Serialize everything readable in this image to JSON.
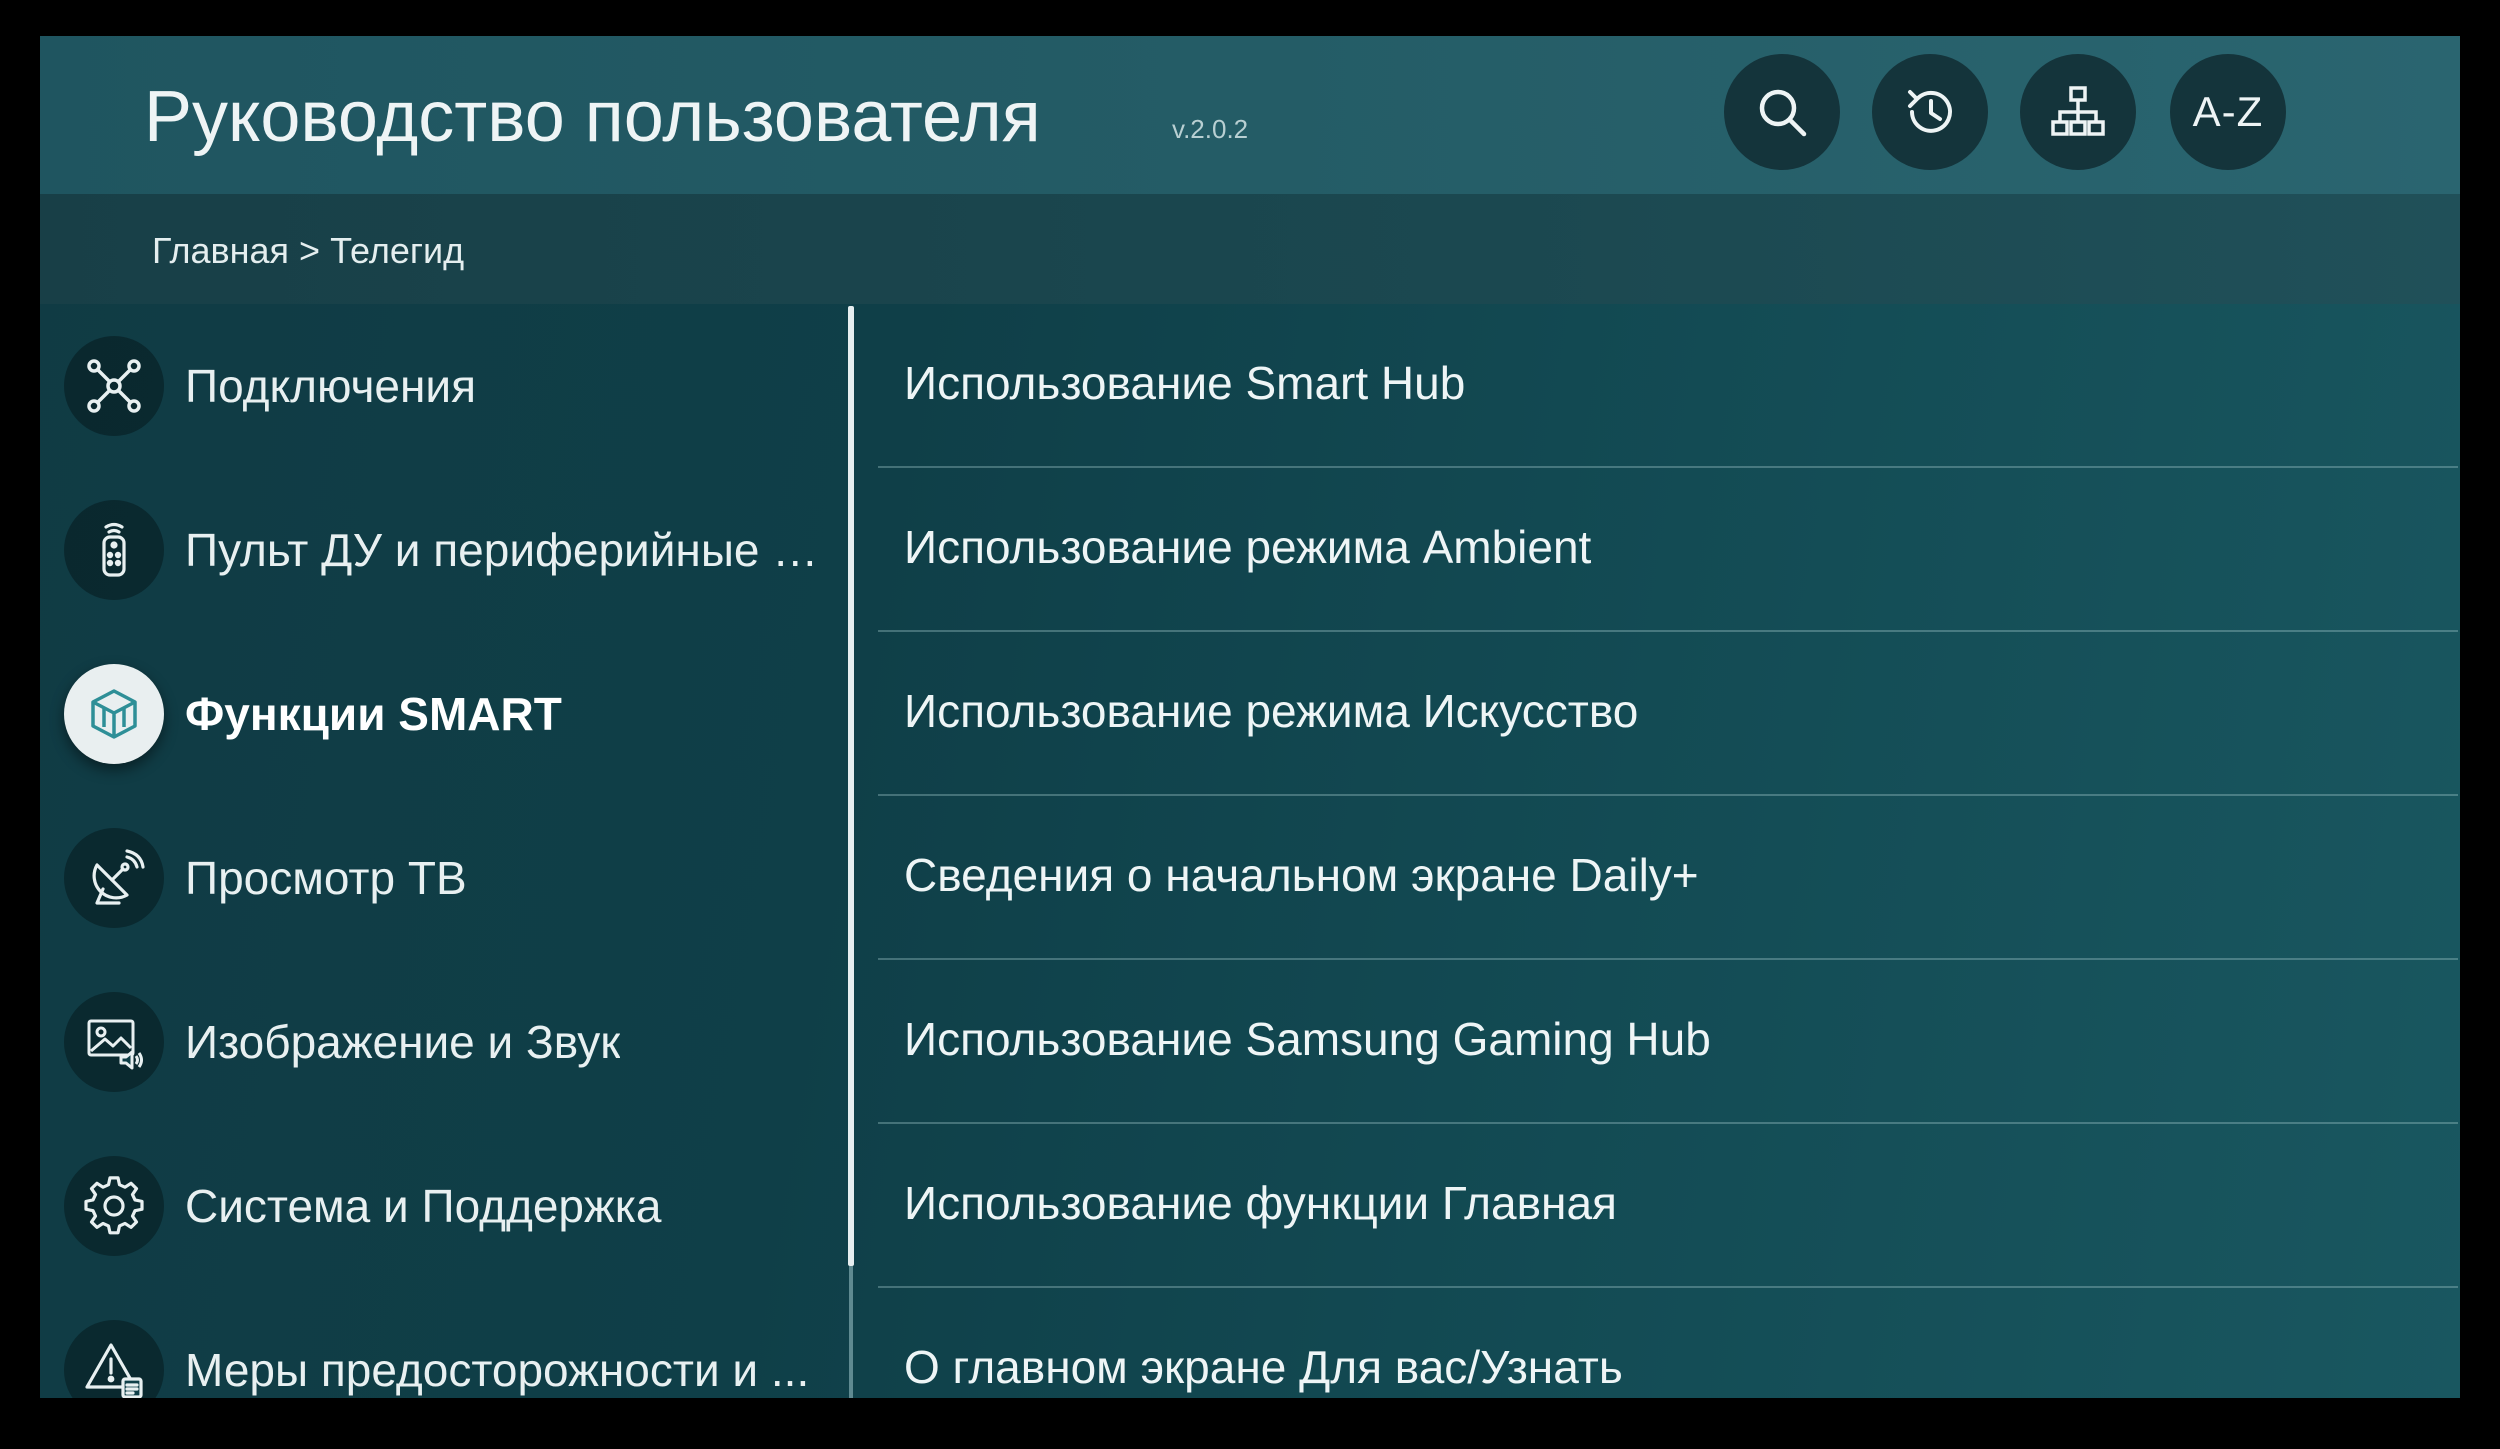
{
  "header": {
    "title": "Руководство пользователя",
    "version": "v.2.0.2",
    "buttons": {
      "search": "search-icon",
      "history": "history-icon",
      "sitemap": "sitemap-icon",
      "az_label": "A-Z"
    }
  },
  "breadcrumb": {
    "home": "Главная",
    "separator": ">",
    "current": "Телегид"
  },
  "sidebar": {
    "items": [
      {
        "label": "Подключения",
        "icon": "connections-icon"
      },
      {
        "label": "Пульт ДУ и периферийные у...",
        "icon": "remote-icon"
      },
      {
        "label": "Функции SMART",
        "icon": "smart-cube-icon",
        "selected": true
      },
      {
        "label": "Просмотр ТВ",
        "icon": "satellite-dish-icon"
      },
      {
        "label": "Изображение и Звук",
        "icon": "picture-sound-icon"
      },
      {
        "label": "Система и Поддержка",
        "icon": "gear-icon"
      },
      {
        "label": "Меры предосторожности и ...",
        "icon": "warning-icon"
      }
    ]
  },
  "content": {
    "items": [
      "Использование Smart Hub",
      "Использование режима Ambient",
      "Использование режима Искусство",
      "Сведения о начальном экране Daily+",
      "Использование Samsung Gaming Hub",
      "Использование функции Главная",
      "О главном экране Для вас/Узнать"
    ]
  },
  "colors": {
    "accent_active": "#e9eff0",
    "icon_active": "#2e8f97",
    "header_bg": "#245c66"
  }
}
